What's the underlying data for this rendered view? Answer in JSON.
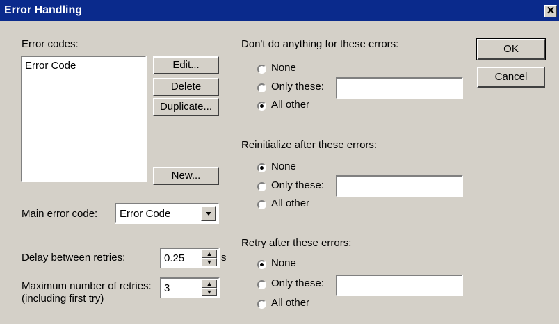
{
  "window": {
    "title": "Error Handling",
    "close_glyph": "✕"
  },
  "error_codes": {
    "label": "Error codes:",
    "items": [
      "Error Code"
    ]
  },
  "buttons": {
    "edit": "Edit...",
    "delete": "Delete",
    "duplicate": "Duplicate...",
    "new": "New...",
    "ok": "OK",
    "cancel": "Cancel"
  },
  "main_error_code": {
    "label": "Main error code:",
    "value": "Error Code"
  },
  "delay": {
    "label": "Delay between retries:",
    "value": "0.25",
    "unit": "s"
  },
  "max_retries": {
    "label_line1": "Maximum number of retries:",
    "label_line2": "(including first try)",
    "value": "3"
  },
  "groups": [
    {
      "title": "Don't do anything for these errors:",
      "options": [
        "None",
        "Only these:",
        "All other"
      ],
      "selected": 2,
      "only_value": ""
    },
    {
      "title": "Reinitialize after these errors:",
      "options": [
        "None",
        "Only these:",
        "All other"
      ],
      "selected": 0,
      "only_value": ""
    },
    {
      "title": "Retry after these errors:",
      "options": [
        "None",
        "Only these:",
        "All other"
      ],
      "selected": 0,
      "only_value": ""
    }
  ]
}
